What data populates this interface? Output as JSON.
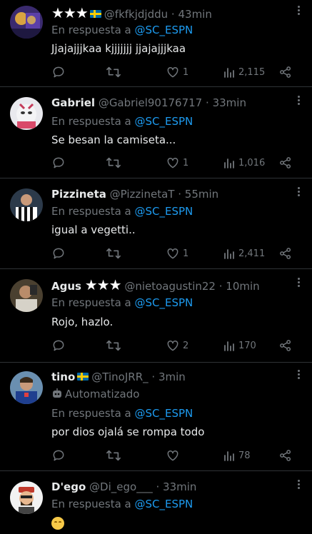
{
  "tweets": [
    {
      "stars": "★★★",
      "handle": "@fkfkjdjddu",
      "sep": "·",
      "time": "43min",
      "reply_prefix": "En respuesta a ",
      "reply_mention": "@SC_ESPN",
      "text": "Jjajajjjkaa kjjjjjjj jjajajjjkaa",
      "likes": "1",
      "views": "2,115"
    },
    {
      "name": "Gabriel",
      "handle": "@Gabriel90176717",
      "sep": "·",
      "time": "33min",
      "reply_prefix": "En respuesta a ",
      "reply_mention": "@SC_ESPN",
      "text": "Se besan la camiseta...",
      "likes": "1",
      "views": "1,016"
    },
    {
      "name": "Pizzineta",
      "handle": "@PizzinetaT",
      "sep": "·",
      "time": "55min",
      "reply_prefix": "En respuesta a ",
      "reply_mention": "@SC_ESPN",
      "text": "igual a vegetti..",
      "likes": "1",
      "views": "2,411"
    },
    {
      "name": "Agus",
      "stars": "★★★",
      "handle": "@nietoagustin22",
      "sep": "·",
      "time": "10min",
      "reply_prefix": "En respuesta a ",
      "reply_mention": "@SC_ESPN",
      "text": "Rojo, hazlo.",
      "likes": "2",
      "views": "170"
    },
    {
      "name": "tino",
      "handle": "@TinoJRR_",
      "sep": "·",
      "time": "3min",
      "automated": "Automatizado",
      "reply_prefix": "En respuesta a ",
      "reply_mention": "@SC_ESPN",
      "text": "por dios ojalá se rompa todo",
      "likes": "",
      "views": "78"
    },
    {
      "name": "D'ego",
      "handle": "@Di_ego___",
      "sep": "·",
      "time": "33min",
      "reply_prefix": "En respuesta a ",
      "reply_mention": "@SC_ESPN",
      "emoji": "smiling-face-emoji"
    }
  ],
  "colors": {
    "background": "#000000",
    "text": "#e7e9ea",
    "muted": "#71767b",
    "mention": "#1d9bf0",
    "divider": "#2f3336"
  },
  "icons": [
    "reply-icon",
    "retweet-icon",
    "like-icon",
    "views-icon",
    "share-icon",
    "more-icon",
    "robot-icon",
    "swedish-flag-icon"
  ]
}
